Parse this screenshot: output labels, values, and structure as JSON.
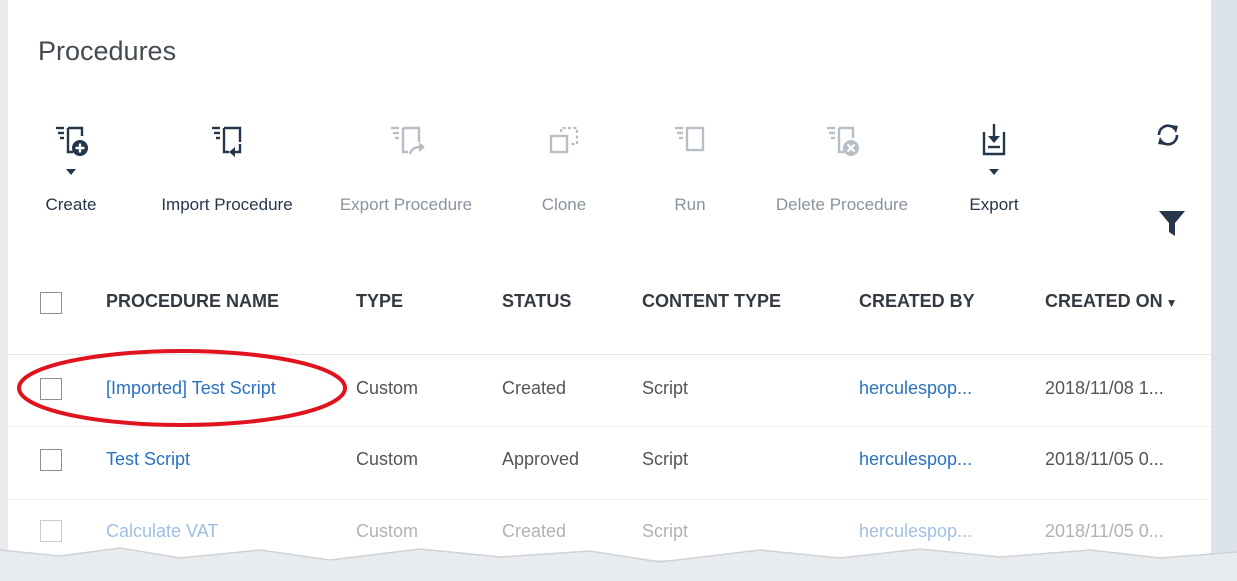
{
  "page": {
    "title": "Procedures"
  },
  "toolbar": {
    "create": "Create",
    "import_procedure": "Import Procedure",
    "export_procedure": "Export Procedure",
    "clone": "Clone",
    "run": "Run",
    "delete_procedure": "Delete Procedure",
    "export": "Export"
  },
  "side_icons": [
    "refresh-icon",
    "filter-icon"
  ],
  "colors": {
    "accent": "#26364a",
    "link": "#2a71bf",
    "highlight": "#e0141e",
    "disabled": "#b8bec6"
  },
  "table": {
    "columns": [
      "PROCEDURE NAME",
      "TYPE",
      "STATUS",
      "CONTENT TYPE",
      "CREATED BY",
      "CREATED ON"
    ],
    "sort_column": "CREATED ON",
    "sort_direction": "descending",
    "rows": [
      {
        "name": "[Imported] Test Script",
        "type": "Custom",
        "status": "Created",
        "content_type": "Script",
        "created_by": "herculespop...",
        "created_on": "2018/11/08 1..."
      },
      {
        "name": "Test Script",
        "type": "Custom",
        "status": "Approved",
        "content_type": "Script",
        "created_by": "herculespop...",
        "created_on": "2018/11/05 0..."
      },
      {
        "name": "Calculate VAT",
        "type": "Custom",
        "status": "Created",
        "content_type": "Script",
        "created_by": "herculespop...",
        "created_on": "2018/11/05 0..."
      }
    ]
  }
}
